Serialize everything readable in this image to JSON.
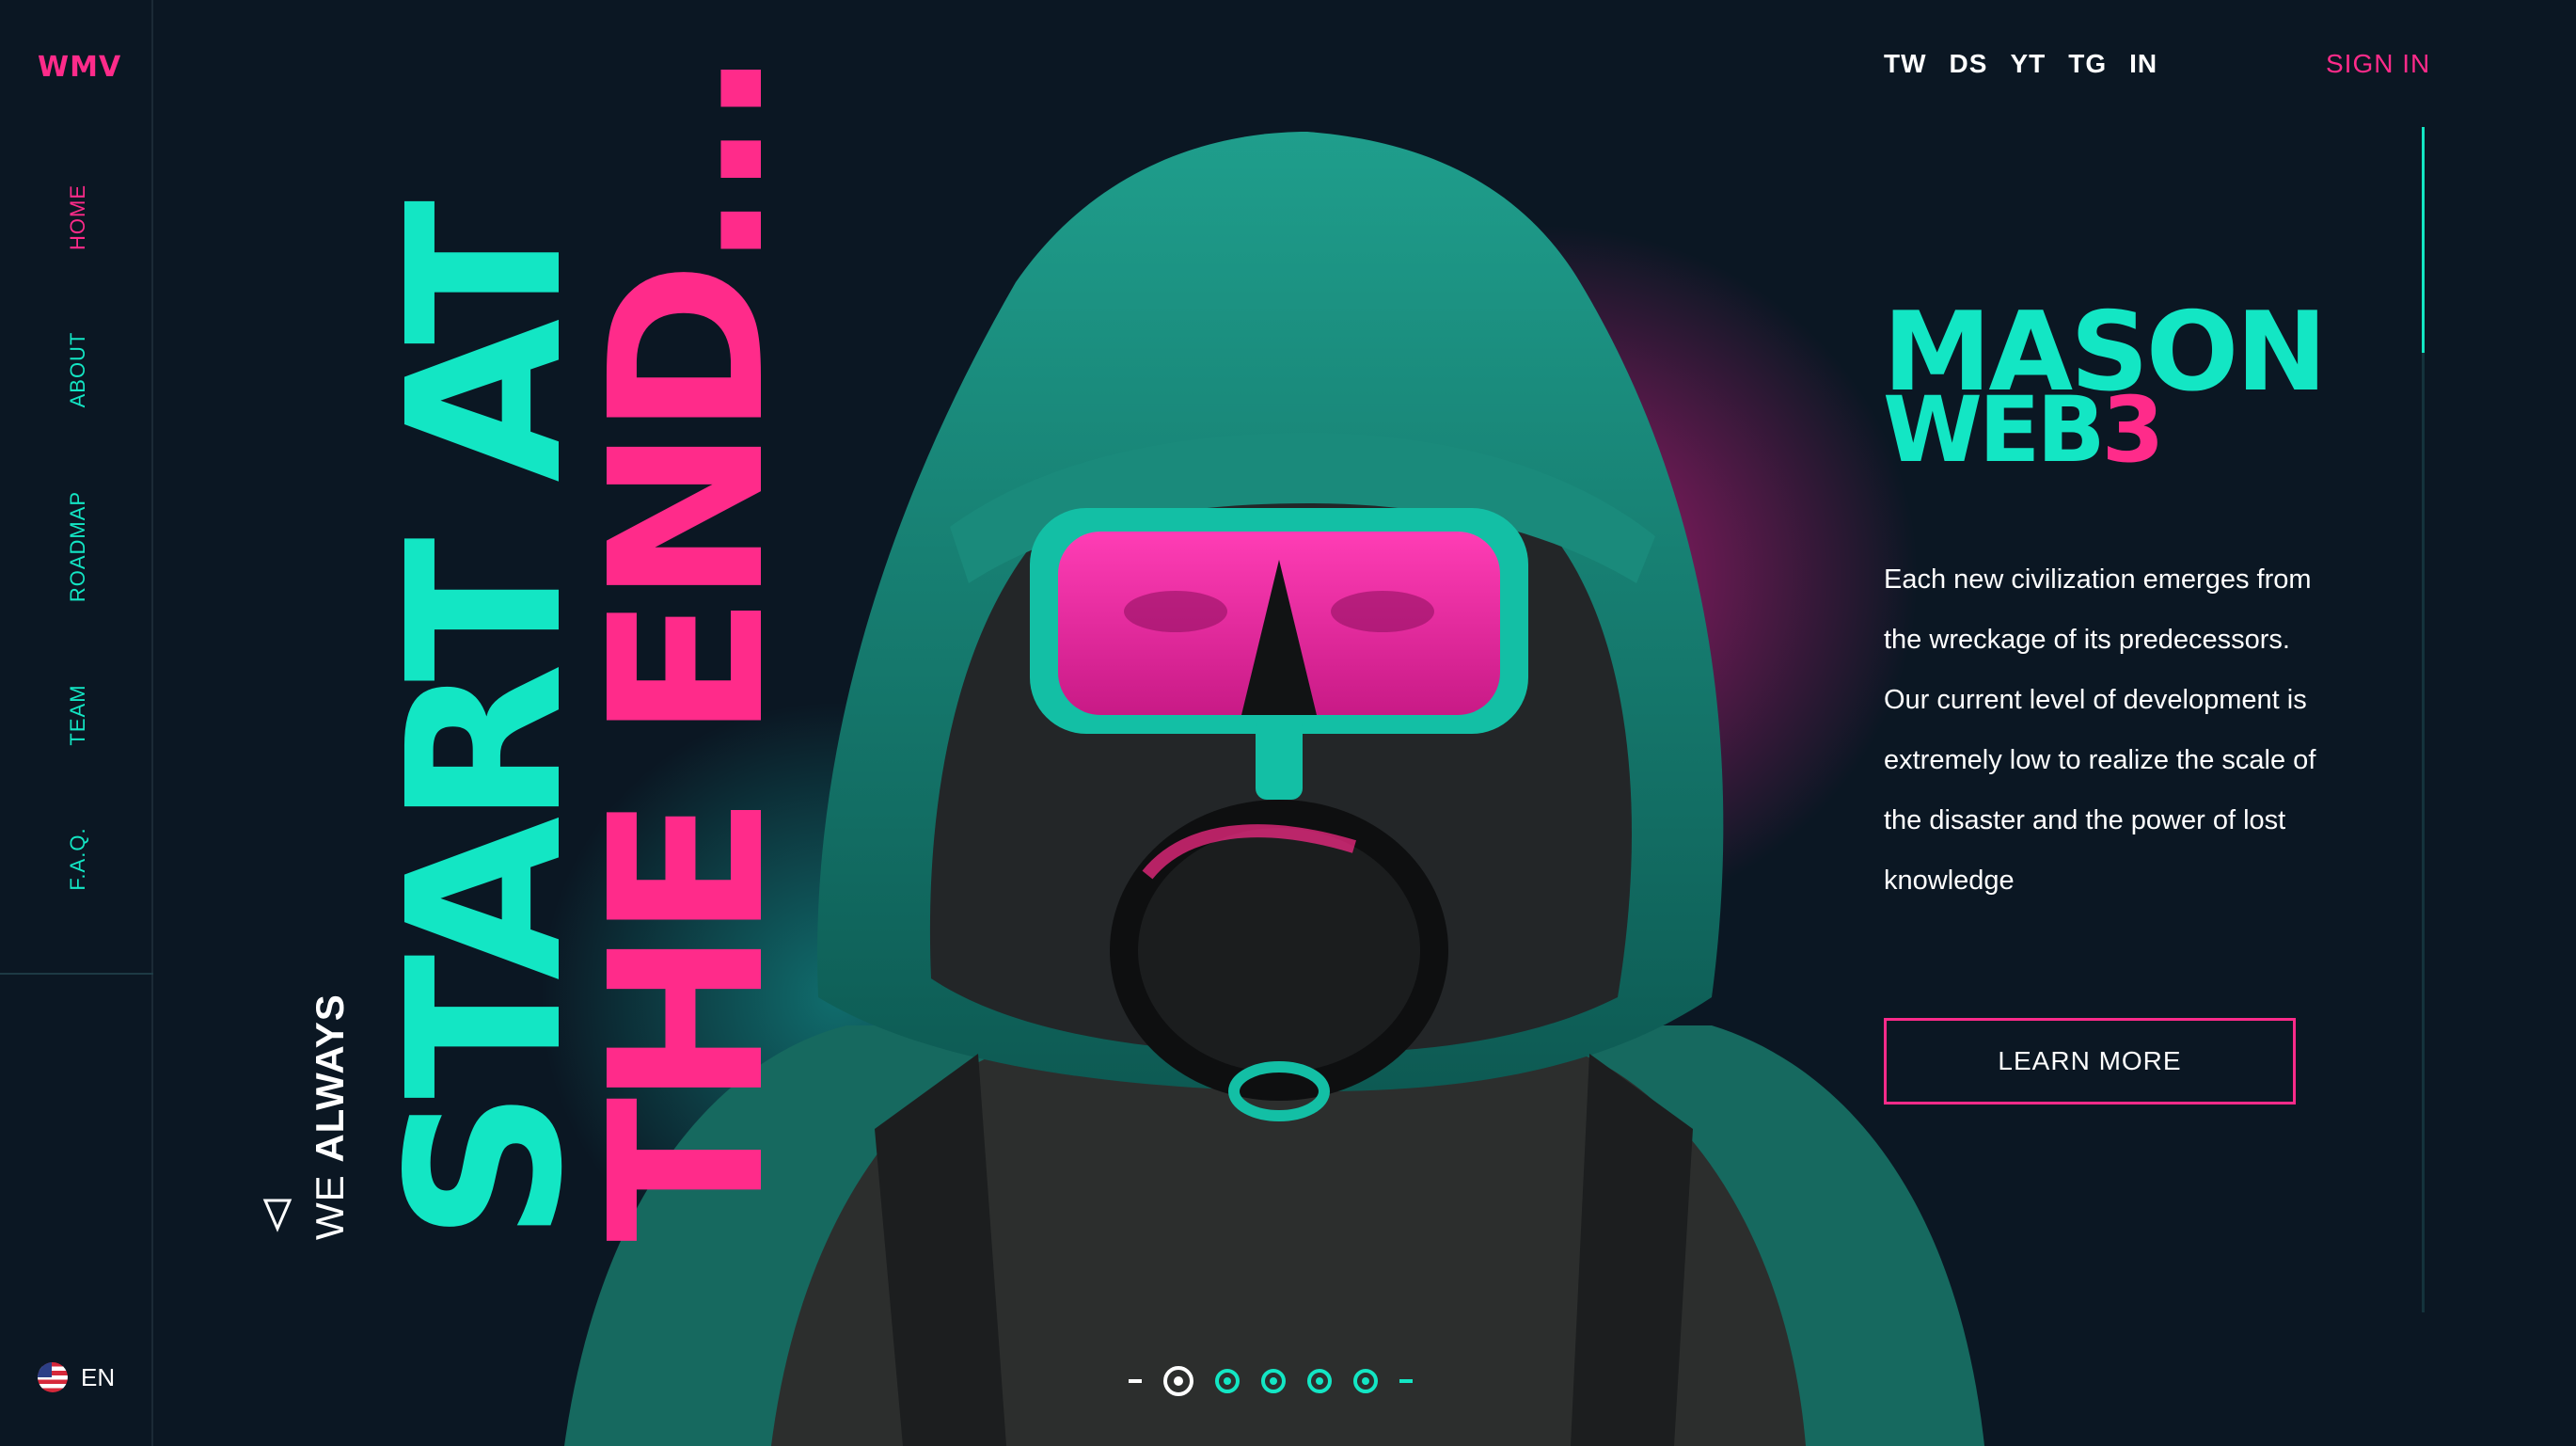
{
  "brand": {
    "logo": "WMV"
  },
  "nav": {
    "items": [
      {
        "label": "HOME",
        "active": true
      },
      {
        "label": "ABOUT",
        "active": false
      },
      {
        "label": "ROADMAP",
        "active": false
      },
      {
        "label": "TEAM",
        "active": false
      },
      {
        "label": "F.A.Q.",
        "active": false
      }
    ]
  },
  "language": {
    "label": "EN",
    "flag_icon": "us-flag-icon"
  },
  "social": [
    "TW",
    "DS",
    "YT",
    "TG",
    "IN"
  ],
  "header": {
    "sign_in": "SIGN IN"
  },
  "hero": {
    "line_start": "START AT",
    "line_end": "THE END...",
    "prefix_we": "WE",
    "prefix_always": "ALWAYS",
    "arrow_icon": "arrow-triangle-icon",
    "illustration": "hooded-figure-gas-mask-illustration"
  },
  "info": {
    "title_line1": "MASON",
    "title_line2": "WEB",
    "title_accent": "3",
    "description": "Each new civilization emerges from the wreckage of its predecessors. Our current level of development is extremely low to realize the scale of the disaster and the power of lost knowledge",
    "cta": "LEARN MORE"
  },
  "pagination": {
    "pages": 5,
    "current": 1
  },
  "colors": {
    "background": "#0b1723",
    "teal": "#13e6c4",
    "pink": "#ff2b8a"
  }
}
